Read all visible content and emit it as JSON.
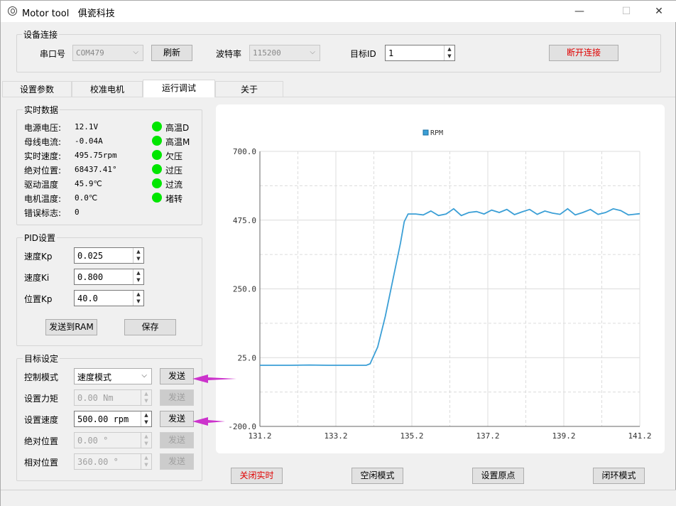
{
  "window": {
    "title": "Motor tool",
    "company": "俱瓷科技",
    "minimize": "—",
    "maximize": "☐",
    "close": "✕"
  },
  "connection": {
    "group_title": "设备连接",
    "port_label": "串口号",
    "port_value": "COM479",
    "refresh_label": "刷新",
    "baud_label": "波特率",
    "baud_value": "115200",
    "target_id_label": "目标ID",
    "target_id_value": "1",
    "disconnect_label": "断开连接"
  },
  "tabs": [
    {
      "label": "设置参数",
      "active": false
    },
    {
      "label": "校准电机",
      "active": false
    },
    {
      "label": "运行调试",
      "active": true
    },
    {
      "label": "关于",
      "active": false
    }
  ],
  "realtime": {
    "group_title": "实时数据",
    "rows": [
      {
        "label": "电源电压:",
        "value": "12.1V"
      },
      {
        "label": "母线电流:",
        "value": "-0.04A"
      },
      {
        "label": "实时速度:",
        "value": "495.75rpm"
      },
      {
        "label": "绝对位置:",
        "value": "68437.41°"
      },
      {
        "label": "驱动温度",
        "value": "45.9℃"
      },
      {
        "label": "电机温度:",
        "value": "0.0℃"
      },
      {
        "label": "错误标志:",
        "value": "0"
      }
    ],
    "indicators": [
      {
        "label": "高温D",
        "color": "#00e600"
      },
      {
        "label": "高温M",
        "color": "#00e600"
      },
      {
        "label": "欠压",
        "color": "#00e600"
      },
      {
        "label": "过压",
        "color": "#00e600"
      },
      {
        "label": "过流",
        "color": "#00e600"
      },
      {
        "label": "堵转",
        "color": "#00e600"
      }
    ]
  },
  "pid": {
    "group_title": "PID设置",
    "speed_kp_label": "速度Kp",
    "speed_kp_value": "0.025",
    "speed_ki_label": "速度Ki",
    "speed_ki_value": "0.800",
    "pos_kp_label": "位置Kp",
    "pos_kp_value": "40.0",
    "send_ram_label": "发送到RAM",
    "save_label": "保存"
  },
  "target": {
    "group_title": "目标设定",
    "mode_label": "控制模式",
    "mode_value": "速度模式",
    "torque_label": "设置力矩",
    "torque_value": "0.00 Nm",
    "speed_label": "设置速度",
    "speed_value": "500.00 rpm",
    "abs_pos_label": "绝对位置",
    "abs_pos_value": "0.00 °",
    "rel_pos_label": "相对位置",
    "rel_pos_value": "360.00 °",
    "send_label": "发送"
  },
  "bottom_buttons": {
    "close_realtime": "关闭实时",
    "idle_mode": "空闲模式",
    "set_origin": "设置原点",
    "closed_loop": "闭环模式"
  },
  "colors": {
    "line": "#3b9fd6",
    "arrow": "#cc33cc",
    "indicator": "#00e600",
    "danger": "#e00000"
  },
  "chart_data": {
    "type": "line",
    "series": [
      {
        "name": "RPM",
        "x": [
          131.2,
          132.0,
          132.5,
          133.0,
          133.5,
          134.0,
          134.1,
          134.3,
          134.5,
          134.7,
          134.9,
          135.0,
          135.1,
          135.3,
          135.5,
          135.7,
          135.9,
          136.1,
          136.3,
          136.5,
          136.7,
          136.9,
          137.1,
          137.3,
          137.5,
          137.7,
          137.9,
          138.1,
          138.3,
          138.5,
          138.7,
          138.9,
          139.1,
          139.3,
          139.5,
          139.7,
          139.9,
          140.1,
          140.3,
          140.5,
          140.7,
          140.9,
          141.2
        ],
        "values": [
          0,
          0,
          1,
          0,
          0,
          0,
          5,
          60,
          160,
          280,
          400,
          470,
          495,
          495,
          492,
          505,
          490,
          495,
          512,
          490,
          500,
          503,
          495,
          508,
          500,
          510,
          493,
          502,
          510,
          494,
          505,
          498,
          494,
          512,
          492,
          500,
          510,
          494,
          500,
          512,
          506,
          492,
          496
        ]
      }
    ],
    "xticks": [
      "131.2",
      "133.2",
      "135.2",
      "137.2",
      "139.2",
      "141.2"
    ],
    "yticks": [
      "700.0",
      "475.0",
      "250.0",
      "25.0",
      "-200.0"
    ],
    "xlim": [
      131.2,
      141.2
    ],
    "ylim": [
      -200,
      700
    ],
    "legend": "top-center",
    "grid": true
  }
}
